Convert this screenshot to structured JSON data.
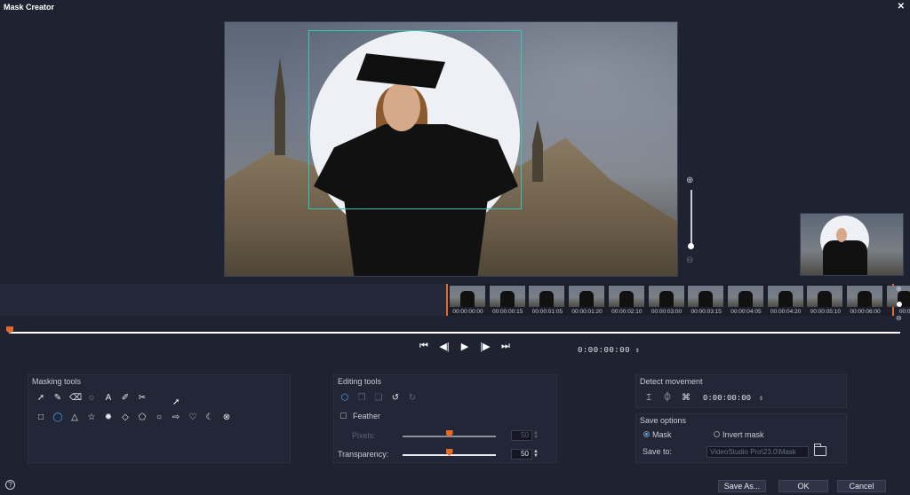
{
  "window": {
    "title": "Mask Creator",
    "close_glyph": "✕"
  },
  "preview": {
    "zoom_in_icon": "zoom-in-icon",
    "zoom_out_icon": "zoom-out-icon"
  },
  "filmstrip": {
    "timestamps": [
      "00:00:00:00",
      "00:00:00:15",
      "00:00:01:05",
      "00:00:01:20",
      "00:00:02:10",
      "00:00:03:00",
      "00:00:03:15",
      "00:00:04:05",
      "00:00:04:20",
      "00:00:05:10",
      "00:00:06:00",
      "00:0"
    ]
  },
  "transport": {
    "buttons": [
      "⏮",
      "◀|",
      "▶",
      "|▶",
      "⏭"
    ],
    "timecode": "0:00:00:00"
  },
  "masking_tools": {
    "title": "Masking tools",
    "row1": [
      {
        "name": "pointer-tool",
        "glyph": "➚"
      },
      {
        "name": "brush-tool",
        "glyph": "✎"
      },
      {
        "name": "eraser-tool",
        "glyph": "⌫"
      },
      {
        "name": "lasso-tool",
        "glyph": "◌"
      },
      {
        "name": "text-tool",
        "glyph": "A"
      },
      {
        "name": "smart-brush-tool",
        "glyph": "✐"
      },
      {
        "name": "smart-eraser-tool",
        "glyph": "✂"
      }
    ],
    "row2": [
      {
        "name": "rectangle-shape",
        "glyph": "□"
      },
      {
        "name": "ellipse-shape",
        "glyph": "◯",
        "active": true
      },
      {
        "name": "triangle-shape",
        "glyph": "△"
      },
      {
        "name": "star-shape",
        "glyph": "☆"
      },
      {
        "name": "burst-shape",
        "glyph": "✹"
      },
      {
        "name": "diamond-shape",
        "glyph": "◇"
      },
      {
        "name": "pentagon-shape",
        "glyph": "⬠"
      },
      {
        "name": "octagon-shape",
        "glyph": "○"
      },
      {
        "name": "arrow-shape",
        "glyph": "⇨"
      },
      {
        "name": "heart-shape",
        "glyph": "♡"
      },
      {
        "name": "moon-shape",
        "glyph": "☾"
      },
      {
        "name": "clear-shape",
        "glyph": "⊗"
      }
    ]
  },
  "editing_tools": {
    "title": "Editing tools",
    "icons": [
      {
        "name": "shape-select-icon",
        "glyph": "⬡",
        "active": true
      },
      {
        "name": "copy-icon",
        "glyph": "❐",
        "dim": true
      },
      {
        "name": "paste-icon",
        "glyph": "❏",
        "dim": true
      },
      {
        "name": "undo-icon",
        "glyph": "↺"
      },
      {
        "name": "redo-icon",
        "glyph": "↻",
        "dim": true
      }
    ],
    "feather_label": "Feather",
    "pixels_label": "Pixels:",
    "pixels_value": "50",
    "pixels_level": 0.5,
    "transparency_label": "Transparency:",
    "transparency_value": "50",
    "transparency_level": 0.5
  },
  "detect_movement": {
    "title": "Detect movement",
    "icons": [
      "track-position-icon",
      "track-center-icon",
      "track-object-icon"
    ],
    "timecode": "0:00:00:00"
  },
  "save_options": {
    "title": "Save options",
    "mask_label": "Mask",
    "invert_label": "Invert mask",
    "save_to_label": "Save to:",
    "path": "VideoStudio Pro\\23.0\\Mask",
    "selected": "Mask"
  },
  "footer": {
    "help": "?",
    "save_as": "Save As...",
    "ok": "OK",
    "cancel": "Cancel"
  }
}
